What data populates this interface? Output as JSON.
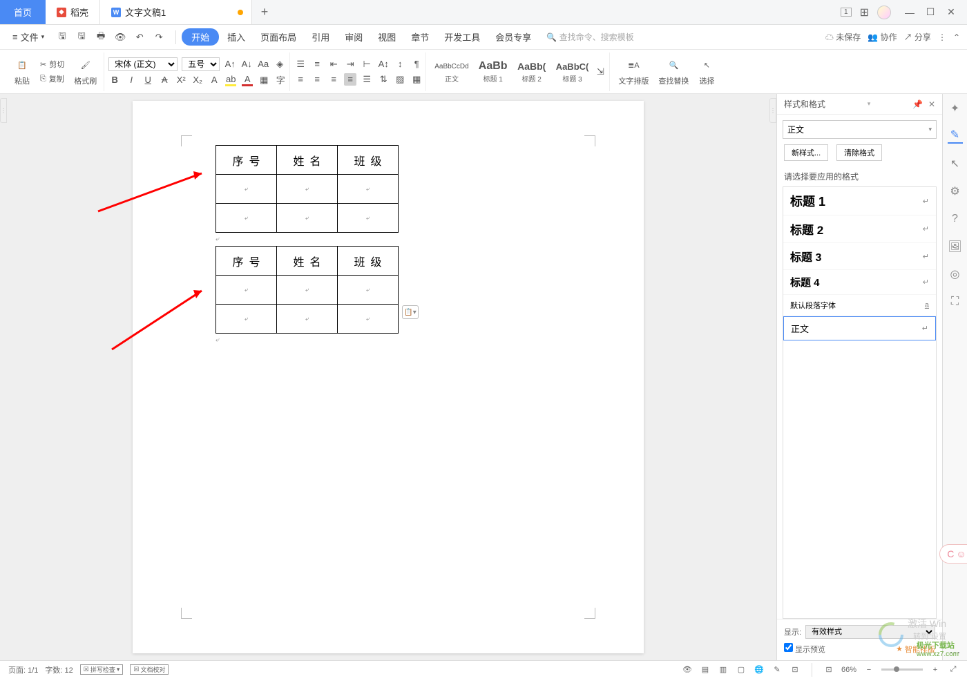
{
  "tabs": {
    "home": "首页",
    "dao": "稻壳",
    "doc": "文字文稿1"
  },
  "window": {
    "grid_count": "1"
  },
  "file_menu": "文件",
  "menu": [
    "开始",
    "插入",
    "页面布局",
    "引用",
    "审阅",
    "视图",
    "章节",
    "开发工具",
    "会员专享"
  ],
  "search": {
    "placeholder": "查找命令、搜索模板"
  },
  "top_right": {
    "unsaved": "未保存",
    "collab": "协作",
    "share": "分享"
  },
  "clipboard": {
    "paste": "粘贴",
    "cut": "剪切",
    "copy": "复制",
    "format_painter": "格式刷"
  },
  "font": {
    "name": "宋体 (正文)",
    "size": "五号"
  },
  "styles_gallery": [
    {
      "preview": "AaBbCcDd",
      "label": "正文"
    },
    {
      "preview": "AaBb",
      "label": "标题 1"
    },
    {
      "preview": "AaBb(",
      "label": "标题 2"
    },
    {
      "preview": "AaBbC(",
      "label": "标题 3"
    }
  ],
  "ribbon_right": {
    "text_layout": "文字排版",
    "find_replace": "查找替换",
    "select": "选择"
  },
  "doc": {
    "headers": [
      "序号",
      "姓名",
      "班级"
    ]
  },
  "panel": {
    "title": "样式和格式",
    "current_style": "正文",
    "new_style_btn": "新样式...",
    "clear_btn": "清除格式",
    "choose_label": "请选择要应用的格式",
    "styles": [
      {
        "name": "标题 1",
        "cls": "h1"
      },
      {
        "name": "标题 2",
        "cls": "h2"
      },
      {
        "name": "标题 3",
        "cls": "h3"
      },
      {
        "name": "标题 4",
        "cls": "h4"
      },
      {
        "name": "默认段落字体",
        "cls": "df",
        "mark": "a"
      },
      {
        "name": "正文",
        "cls": "bd",
        "sel": true
      }
    ],
    "show_label": "显示:",
    "show_value": "有效样式",
    "preview_check": "显示预览",
    "smart": "智能排版"
  },
  "status": {
    "page": "页面: 1/1",
    "words": "字数: 12",
    "spell": "拼写检查",
    "proof": "文档校对",
    "zoom": "66%"
  },
  "watermark": {
    "line1": "激活 Win",
    "line2": "转到\"设置",
    "brand": "极光下载站",
    "url": "www.xz7.com"
  }
}
